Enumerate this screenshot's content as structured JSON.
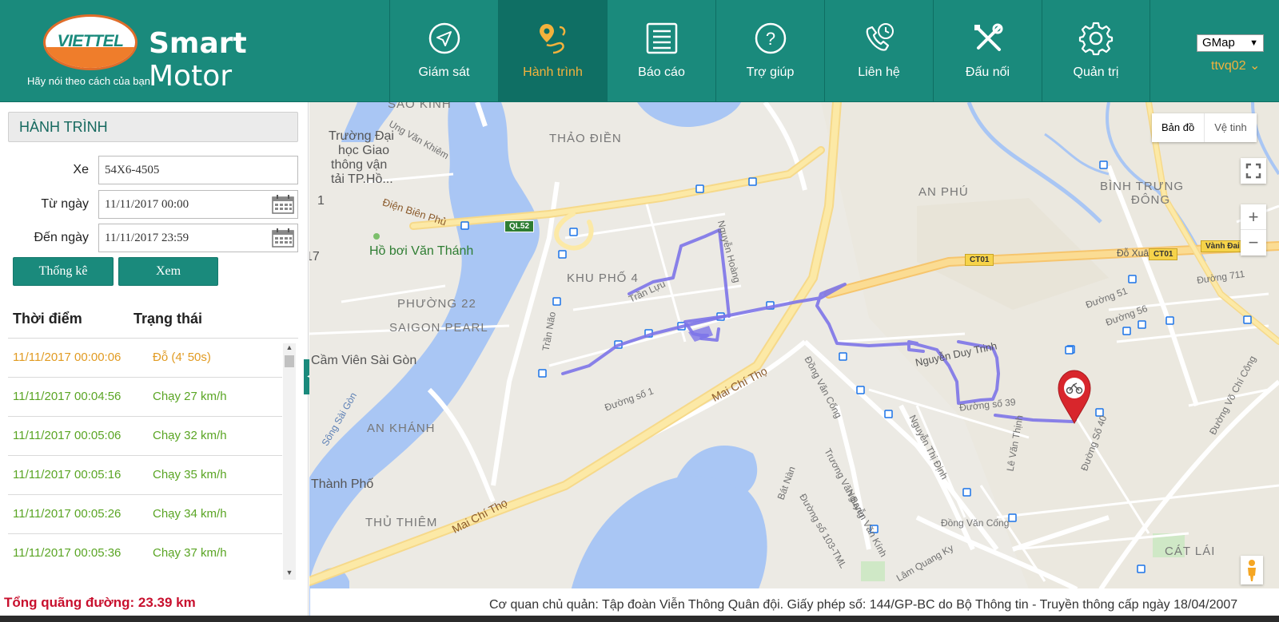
{
  "brand": {
    "logo_text": "VIETTEL",
    "name_bold": "Smart",
    "name_light": " Motor",
    "tagline": "Hãy nói theo cách của bạn"
  },
  "nav": [
    {
      "label": "Giám sát",
      "icon": "compass-arrow-icon",
      "active": false
    },
    {
      "label": "Hành trình",
      "icon": "route-pin-icon",
      "active": true
    },
    {
      "label": "Báo cáo",
      "icon": "report-list-icon",
      "active": false
    },
    {
      "label": "Trợ giúp",
      "icon": "help-question-icon",
      "active": false
    },
    {
      "label": "Liên hệ",
      "icon": "phone-clock-icon",
      "active": false
    },
    {
      "label": "Đấu nối",
      "icon": "tools-icon",
      "active": false
    },
    {
      "label": "Quản trị",
      "icon": "gear-icon",
      "active": false
    }
  ],
  "map_provider": {
    "selected": "GMap"
  },
  "user": {
    "name": "ttvq02"
  },
  "panel": {
    "title": "HÀNH TRÌNH",
    "form": {
      "vehicle_label": "Xe",
      "vehicle_value": "54X6-4505",
      "from_label": "Từ ngày",
      "from_value": "11/11/2017 00:00",
      "to_label": "Đến ngày",
      "to_value": "11/11/2017 23:59"
    },
    "buttons": {
      "stats": "Thống kê",
      "view": "Xem"
    },
    "table": {
      "col_time": "Thời điểm",
      "col_status": "Trạng thái",
      "rows": [
        {
          "time": "11/11/2017 00:00:06",
          "status": "Đỗ (4' 50s)",
          "color": "#e19b22"
        },
        {
          "time": "11/11/2017 00:04:56",
          "status": "Chạy 27 km/h",
          "color": "#5aa524"
        },
        {
          "time": "11/11/2017 00:05:06",
          "status": "Chạy 32 km/h",
          "color": "#5aa524"
        },
        {
          "time": "11/11/2017 00:05:16",
          "status": "Chạy 35 km/h",
          "color": "#5aa524"
        },
        {
          "time": "11/11/2017 00:05:26",
          "status": "Chạy 34 km/h",
          "color": "#5aa524"
        },
        {
          "time": "11/11/2017 00:05:36",
          "status": "Chạy 37 km/h",
          "color": "#5aa524"
        }
      ]
    },
    "total_distance": "Tổng quãng đường: 23.39 km"
  },
  "map": {
    "type_buttons": {
      "map": "Bản đồ",
      "satellite": "Vệ tinh"
    },
    "zoom_in": "+",
    "zoom_out": "−",
    "labels": {
      "thao_dien": "THẢO ĐIỀN",
      "an_phu": "AN PHÚ",
      "binh_trung_dong_1": "BÌNH TRƯNG",
      "binh_trung_dong_2": "ĐÔNG",
      "khu_pho_4": "KHU PHỐ 4",
      "phuong_22": "PHƯỜNG 22",
      "saigon_pearl": "SAIGON PEARL",
      "an_khanh": "AN KHÁNH",
      "thu_thiem": "THỦ THIÊM",
      "cat_lai": "CÁT LÁI",
      "school_1": "Trường Đại",
      "school_2": "học Giao",
      "school_3": "thông vận",
      "school_4": "tải TP.Hồ...",
      "pool": "Hồ bơi Văn Thánh",
      "cam_vien": "Cầm Viên Sài Gòn",
      "thanh_pho": "Thành Phố",
      "dien_bien_phu": "Điện Biên Phủ",
      "mai_chi_tho_1": "Mai Chí Thọ",
      "mai_chi_tho_2": "Mai Chí Thọ",
      "nguyen_duy_trinh": "Nguyễn Duy Trinh",
      "dong_van_cong_1": "Đồng Văn Cống",
      "dong_van_cong_2": "Đồng Văn Cống",
      "nguyen_thi_dinh": "Nguyễn Thị Định",
      "tran_nao": "Trần Não",
      "song_sai_gon": "Sông Sài Gòn",
      "vo_chi_cong": "Đường Võ Chí Công",
      "do_xuan_hop": "Đỗ Xuân Hợp",
      "vanh_dai_2": "Vành Đai 2",
      "duong_711": "Đường 711",
      "duong_51": "Đường 51",
      "duong_56": "Đường 56",
      "duong_so_1": "Đường số 1",
      "duong_so_39": "Đường số 39",
      "duong_so_40": "Đường Số 40",
      "tran_luu": "Trần Lựu",
      "nguyen_hoang": "Nguyễn Hoàng",
      "ung_van_khiem": "Ung Văn Khiêm",
      "sao_kinh": "SAO KINH",
      "le_van_thinh": "Lê Văn Thịnh",
      "truong_van_bang": "Trương Văn Bang",
      "nguyen_van_kinh": "Nguyễn Văn Kính",
      "bat_nan": "Bát Nàn",
      "lam_quang_ky": "Lâm Quang Ky",
      "duong_103": "Đường số 103-TML",
      "number_17": "17",
      "number_1": "1"
    },
    "badges": {
      "ql52": "QL52",
      "ct01_a": "CT01",
      "ct01_b": "CT01",
      "vanh_dai": "Vành Đai 2"
    },
    "footer": "Cơ quan chủ quản: Tập đoàn Viễn Thông Quân đội. Giấy phép số: 144/GP-BC do Bộ Thông tin - Truyền thông cấp ngày 18/04/2007"
  }
}
